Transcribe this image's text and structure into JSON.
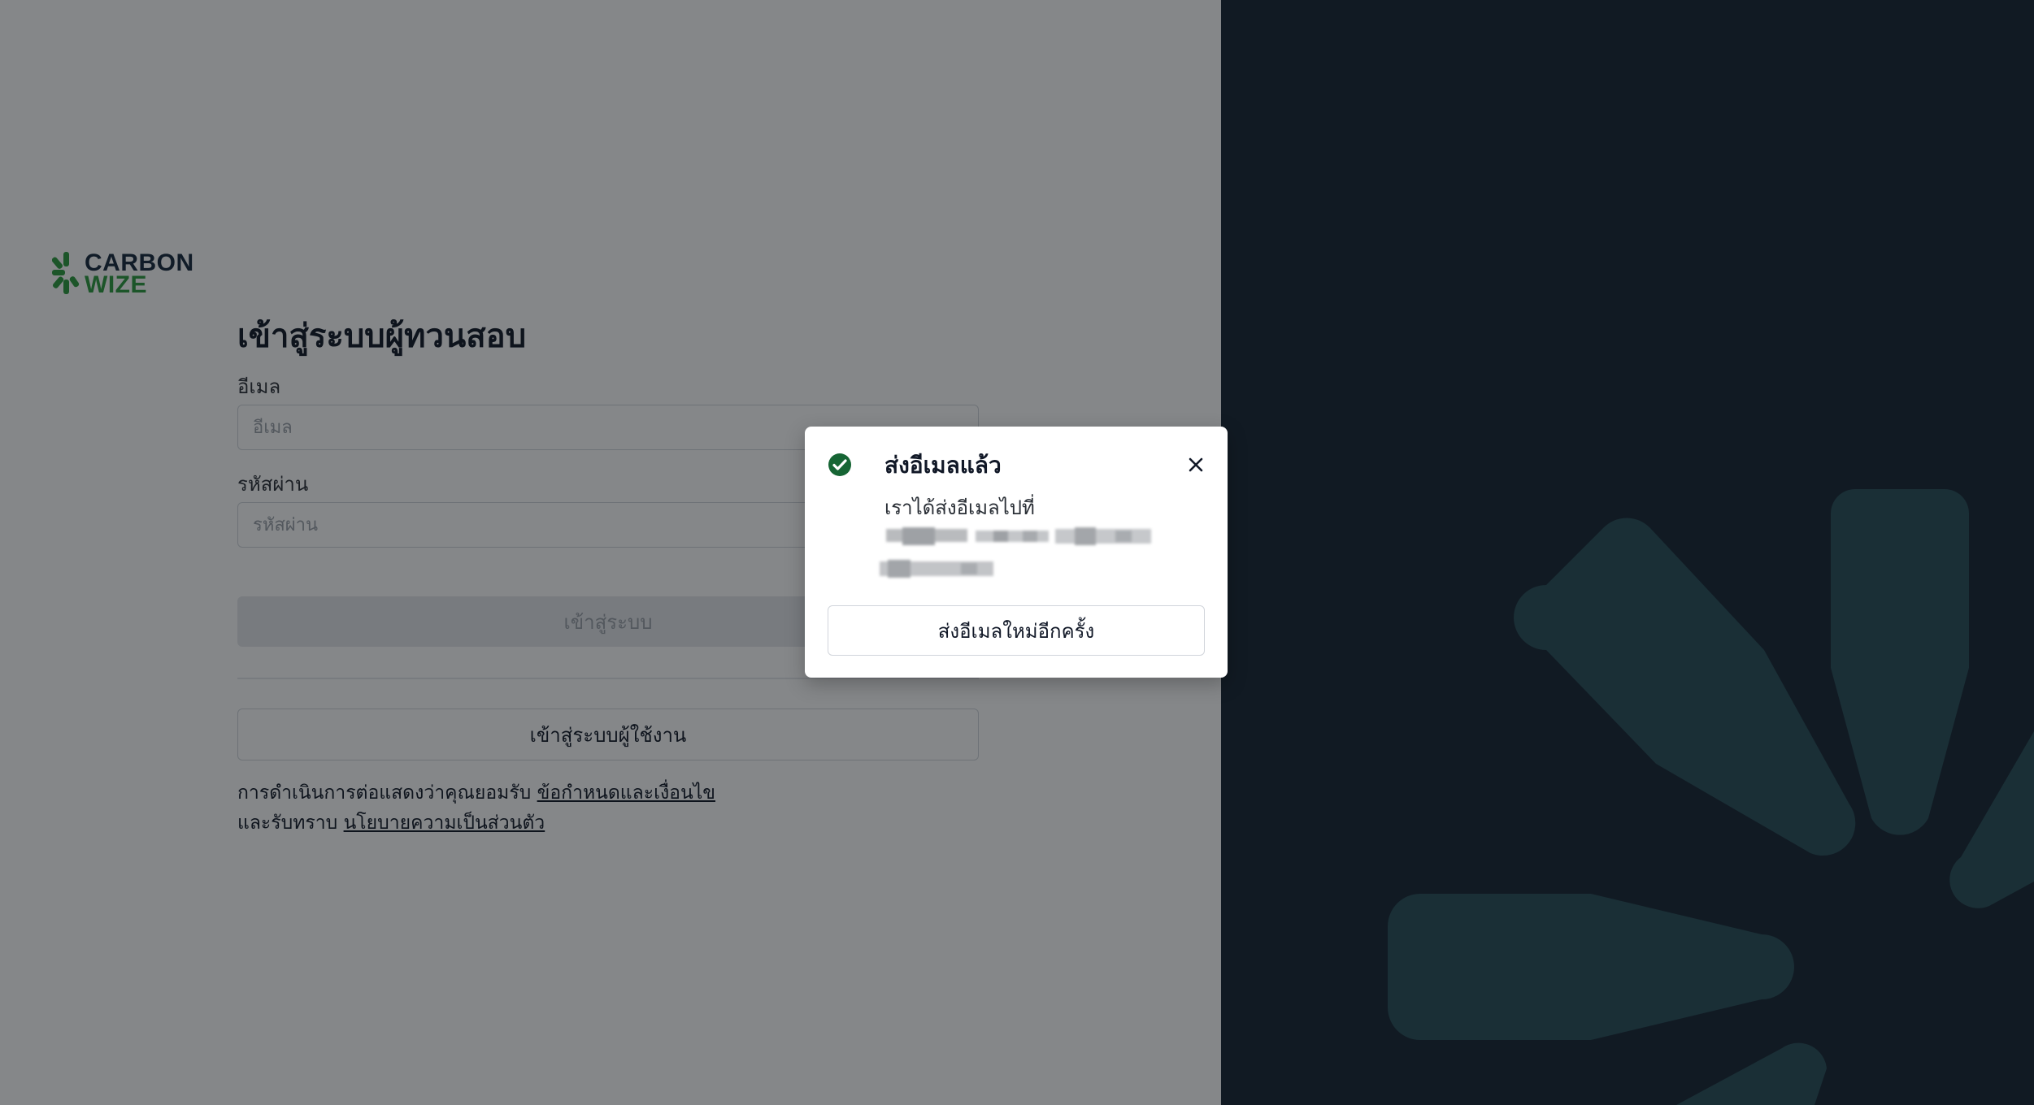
{
  "logo": {
    "line1": "CARBON",
    "line2": "WIZE",
    "primary_color": "#16293d",
    "accent_color": "#2c9b3e"
  },
  "login": {
    "title": "เข้าสู่ระบบผู้ทวนสอบ",
    "email_label": "อีเมล",
    "email_placeholder": "อีเมล",
    "password_label": "รหัสผ่าน",
    "password_placeholder": "รหัสผ่าน",
    "login_button": "เข้าสู่ระบบ",
    "user_login_button": "เข้าสู่ระบบผู้ใช้งาน",
    "terms_prefix": "การดำเนินการต่อแสดงว่าคุณยอมรับ",
    "terms_link": "ข้อกำหนดและเงื่อนไข",
    "privacy_prefix": "และรับทราบ",
    "privacy_link": "นโยบายความเป็นส่วนตัว"
  },
  "modal": {
    "title": "ส่งอีเมลแล้ว",
    "body": "เราได้ส่งอีเมลไปที่",
    "resend_button": "ส่งอีเมลใหม่อีกครั้ง",
    "icons": {
      "status": "check-circle-icon",
      "close": "close-icon"
    },
    "success_color": "#166534"
  },
  "theme": {
    "right_panel_bg": "#111a23",
    "decor_color": "#1a2f36"
  }
}
